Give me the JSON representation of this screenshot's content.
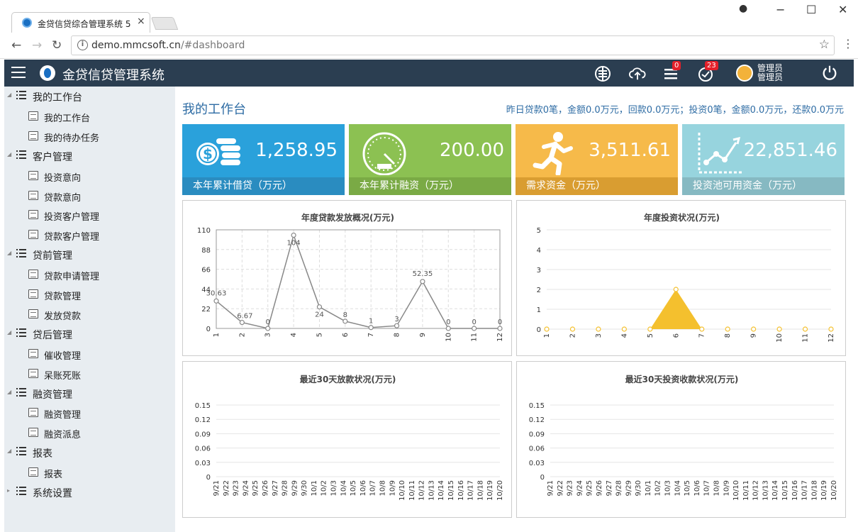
{
  "browser": {
    "tab_title": "金贷信贷综合管理系统 5",
    "tab_close": "×",
    "url_host": "demo.mmcsoft.cn",
    "url_path": "/#dashboard",
    "window_controls": [
      "−",
      "☐",
      "✕"
    ]
  },
  "header": {
    "app_title": "金贷信贷管理系统",
    "menu_badge": "0",
    "task_badge": "23",
    "user_line1": "管理员",
    "user_line2": "管理员"
  },
  "sidebar": {
    "groups": [
      {
        "label": "我的工作台",
        "items": [
          "我的工作台",
          "我的待办任务"
        ]
      },
      {
        "label": "客户管理",
        "items": [
          "投资意向",
          "贷款意向",
          "投资客户管理",
          "贷款客户管理"
        ]
      },
      {
        "label": "贷前管理",
        "items": [
          "贷款申请管理",
          "贷款管理",
          "发放贷款"
        ]
      },
      {
        "label": "贷后管理",
        "items": [
          "催收管理",
          "呆账死账"
        ]
      },
      {
        "label": "融资管理",
        "items": [
          "融资管理",
          "融资派息"
        ]
      },
      {
        "label": "报表",
        "items": [
          "报表"
        ]
      },
      {
        "label": "系统设置",
        "items": []
      }
    ]
  },
  "main": {
    "title": "我的工作台",
    "summary": "昨日贷款0笔，金额0.0万元，回款0.0万元；投资0笔，金额0.0万元，还款0.0万元",
    "cards": [
      {
        "value": "1,258.95",
        "label": "本年累计借贷（万元）",
        "color": "#2aa1db",
        "foot": "#2a8cc0"
      },
      {
        "value": "200.00",
        "label": "本年累计融资（万元）",
        "color": "#8cc152",
        "foot": "#7aaa45"
      },
      {
        "value": "3,511.61",
        "label": "需求资金（万元）",
        "color": "#f6ba4a",
        "foot": "#d99d31"
      },
      {
        "value": "22,851.46",
        "label": "投资池可用资金（万元）",
        "color": "#97d4de",
        "foot": "#86b9c2"
      }
    ]
  },
  "chart_data": [
    {
      "type": "line",
      "title": "年度贷款发放概况(万元)",
      "categories": [
        "1",
        "2",
        "3",
        "4",
        "5",
        "6",
        "7",
        "8",
        "9",
        "10",
        "11",
        "12"
      ],
      "values": [
        30.63,
        6.67,
        0,
        104,
        24,
        8,
        1,
        3,
        52.35,
        0,
        0,
        0
      ],
      "labels": [
        "30.63",
        "6.67",
        "0",
        "104",
        "24",
        "8",
        "1",
        "3",
        "52.35",
        "0",
        "0",
        "0"
      ],
      "ylim": [
        0,
        110
      ],
      "yticks": [
        "0",
        "22",
        "44",
        "66",
        "88",
        "110"
      ],
      "grid": true
    },
    {
      "type": "area",
      "title": "年度投资状况(万元)",
      "categories": [
        "1",
        "2",
        "3",
        "4",
        "5",
        "6",
        "7",
        "8",
        "9",
        "10",
        "11",
        "12"
      ],
      "values": [
        0,
        0,
        0,
        0,
        0,
        2,
        0,
        0,
        0,
        0,
        0,
        0
      ],
      "ylim": [
        0,
        5
      ],
      "yticks": [
        "0",
        "1",
        "2",
        "3",
        "4",
        "5"
      ],
      "color": "#f4c02e",
      "grid": true
    },
    {
      "type": "line",
      "title": "最近30天放款状况(万元)",
      "categories": [
        "9/21",
        "9/22",
        "9/23",
        "9/24",
        "9/25",
        "9/26",
        "9/27",
        "9/28",
        "9/29",
        "9/30",
        "10/1",
        "10/2",
        "10/3",
        "10/4",
        "10/5",
        "10/6",
        "10/7",
        "10/8",
        "10/9",
        "10/10",
        "10/11",
        "10/12",
        "10/13",
        "10/14",
        "10/15",
        "10/16",
        "10/17",
        "10/18",
        "10/19",
        "10/20"
      ],
      "ylim": [
        0,
        0.15
      ],
      "yticks": [
        "0",
        "0.03",
        "0.06",
        "0.09",
        "0.12",
        "0.15"
      ],
      "grid": true
    },
    {
      "type": "line",
      "title": "最近30天投资收款状况(万元)",
      "categories": [
        "9/21",
        "9/22",
        "9/23",
        "9/24",
        "9/25",
        "9/26",
        "9/27",
        "9/28",
        "9/29",
        "9/30",
        "10/1",
        "10/2",
        "10/3",
        "10/4",
        "10/5",
        "10/6",
        "10/7",
        "10/8",
        "10/9",
        "10/10",
        "10/11",
        "10/12",
        "10/13",
        "10/14",
        "10/15",
        "10/16",
        "10/17",
        "10/18",
        "10/19",
        "10/20"
      ],
      "ylim": [
        0,
        0.15
      ],
      "yticks": [
        "0",
        "0.03",
        "0.06",
        "0.09",
        "0.12",
        "0.15"
      ],
      "grid": true
    }
  ]
}
